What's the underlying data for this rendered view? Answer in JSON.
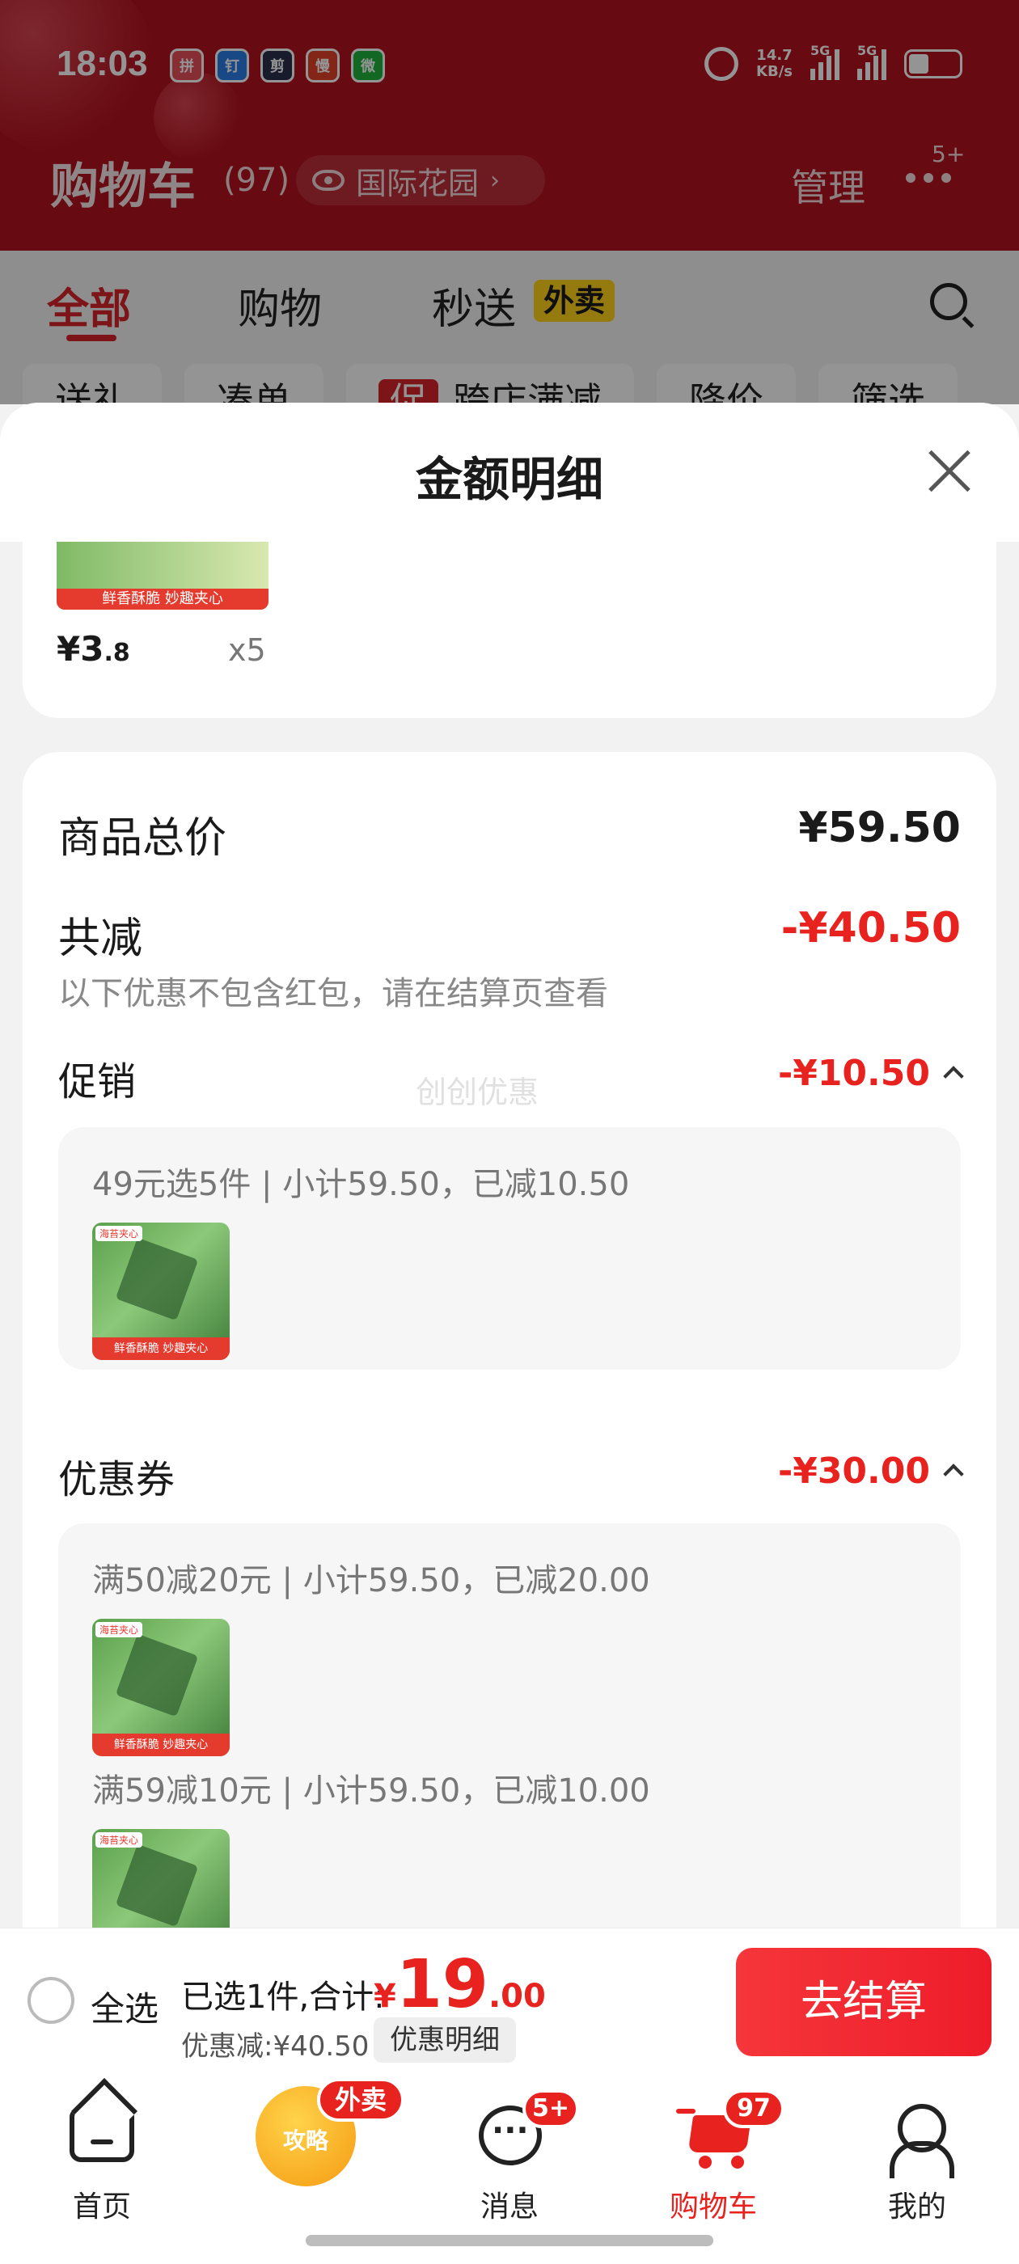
{
  "status_bar": {
    "time": "18:03",
    "speed_value": "14.7",
    "speed_unit": "KB/s",
    "network_1": "5G",
    "network_2": "5G"
  },
  "app_icons": [
    "拼",
    "钉",
    "剪",
    "慢",
    "微"
  ],
  "header": {
    "title": "购物车",
    "count": "(97)",
    "location": "国际花园",
    "manage": "管理",
    "more_badge": "5+"
  },
  "tabs": [
    "全部",
    "购物",
    "秒送"
  ],
  "tab_tag": "外卖",
  "chips": [
    {
      "label": "送礼"
    },
    {
      "label": "凑单"
    },
    {
      "promo": "促",
      "label": "跨店满减"
    },
    {
      "label": "降价"
    },
    {
      "label": "筛选"
    }
  ],
  "sheet": {
    "title": "金额明细"
  },
  "product_top": {
    "price_int": "¥3",
    "price_dec": ".8",
    "qty": "x5",
    "img_caption": "鲜香酥脆 妙趣夹心"
  },
  "summary": {
    "total_label": "商品总价",
    "total_value": "¥59.50",
    "reduce_label": "共减",
    "reduce_value": "-¥40.50",
    "note": "以下优惠不包含红包，请在结算页查看",
    "watermark": "创创优惠",
    "promo_label": "促销",
    "promo_value": "-¥10.50",
    "promo_detail": "49元选5件 | 小计59.50，已减10.50",
    "coupon_label": "优惠券",
    "coupon_value": "-¥30.00",
    "coupon_detail_1": "满50减20元 | 小计59.50，已减20.00",
    "coupon_detail_2": "满59减10元 | 小计59.50，已减10.00",
    "thumb_caption": "鲜香酥脆 妙趣夹心",
    "thumb_tag": "海苔夹心"
  },
  "bottom_bar": {
    "select_all": "全选",
    "selected": "已选1件,合计:",
    "yen": "¥",
    "total_int": "19",
    "total_dec": ".00",
    "discount": "优惠减:¥40.50",
    "detail_button": "优惠明细",
    "checkout": "去结算"
  },
  "tabbar": {
    "home": "首页",
    "gonglue": "攻略",
    "gonglue_badge": "外卖",
    "messages": "消息",
    "messages_badge": "5+",
    "cart": "购物车",
    "cart_badge": "97",
    "me": "我的"
  },
  "colors": {
    "brand_red": "#e8221e",
    "header_red": "#b3121f",
    "accent_yellow": "#ffd21a"
  }
}
